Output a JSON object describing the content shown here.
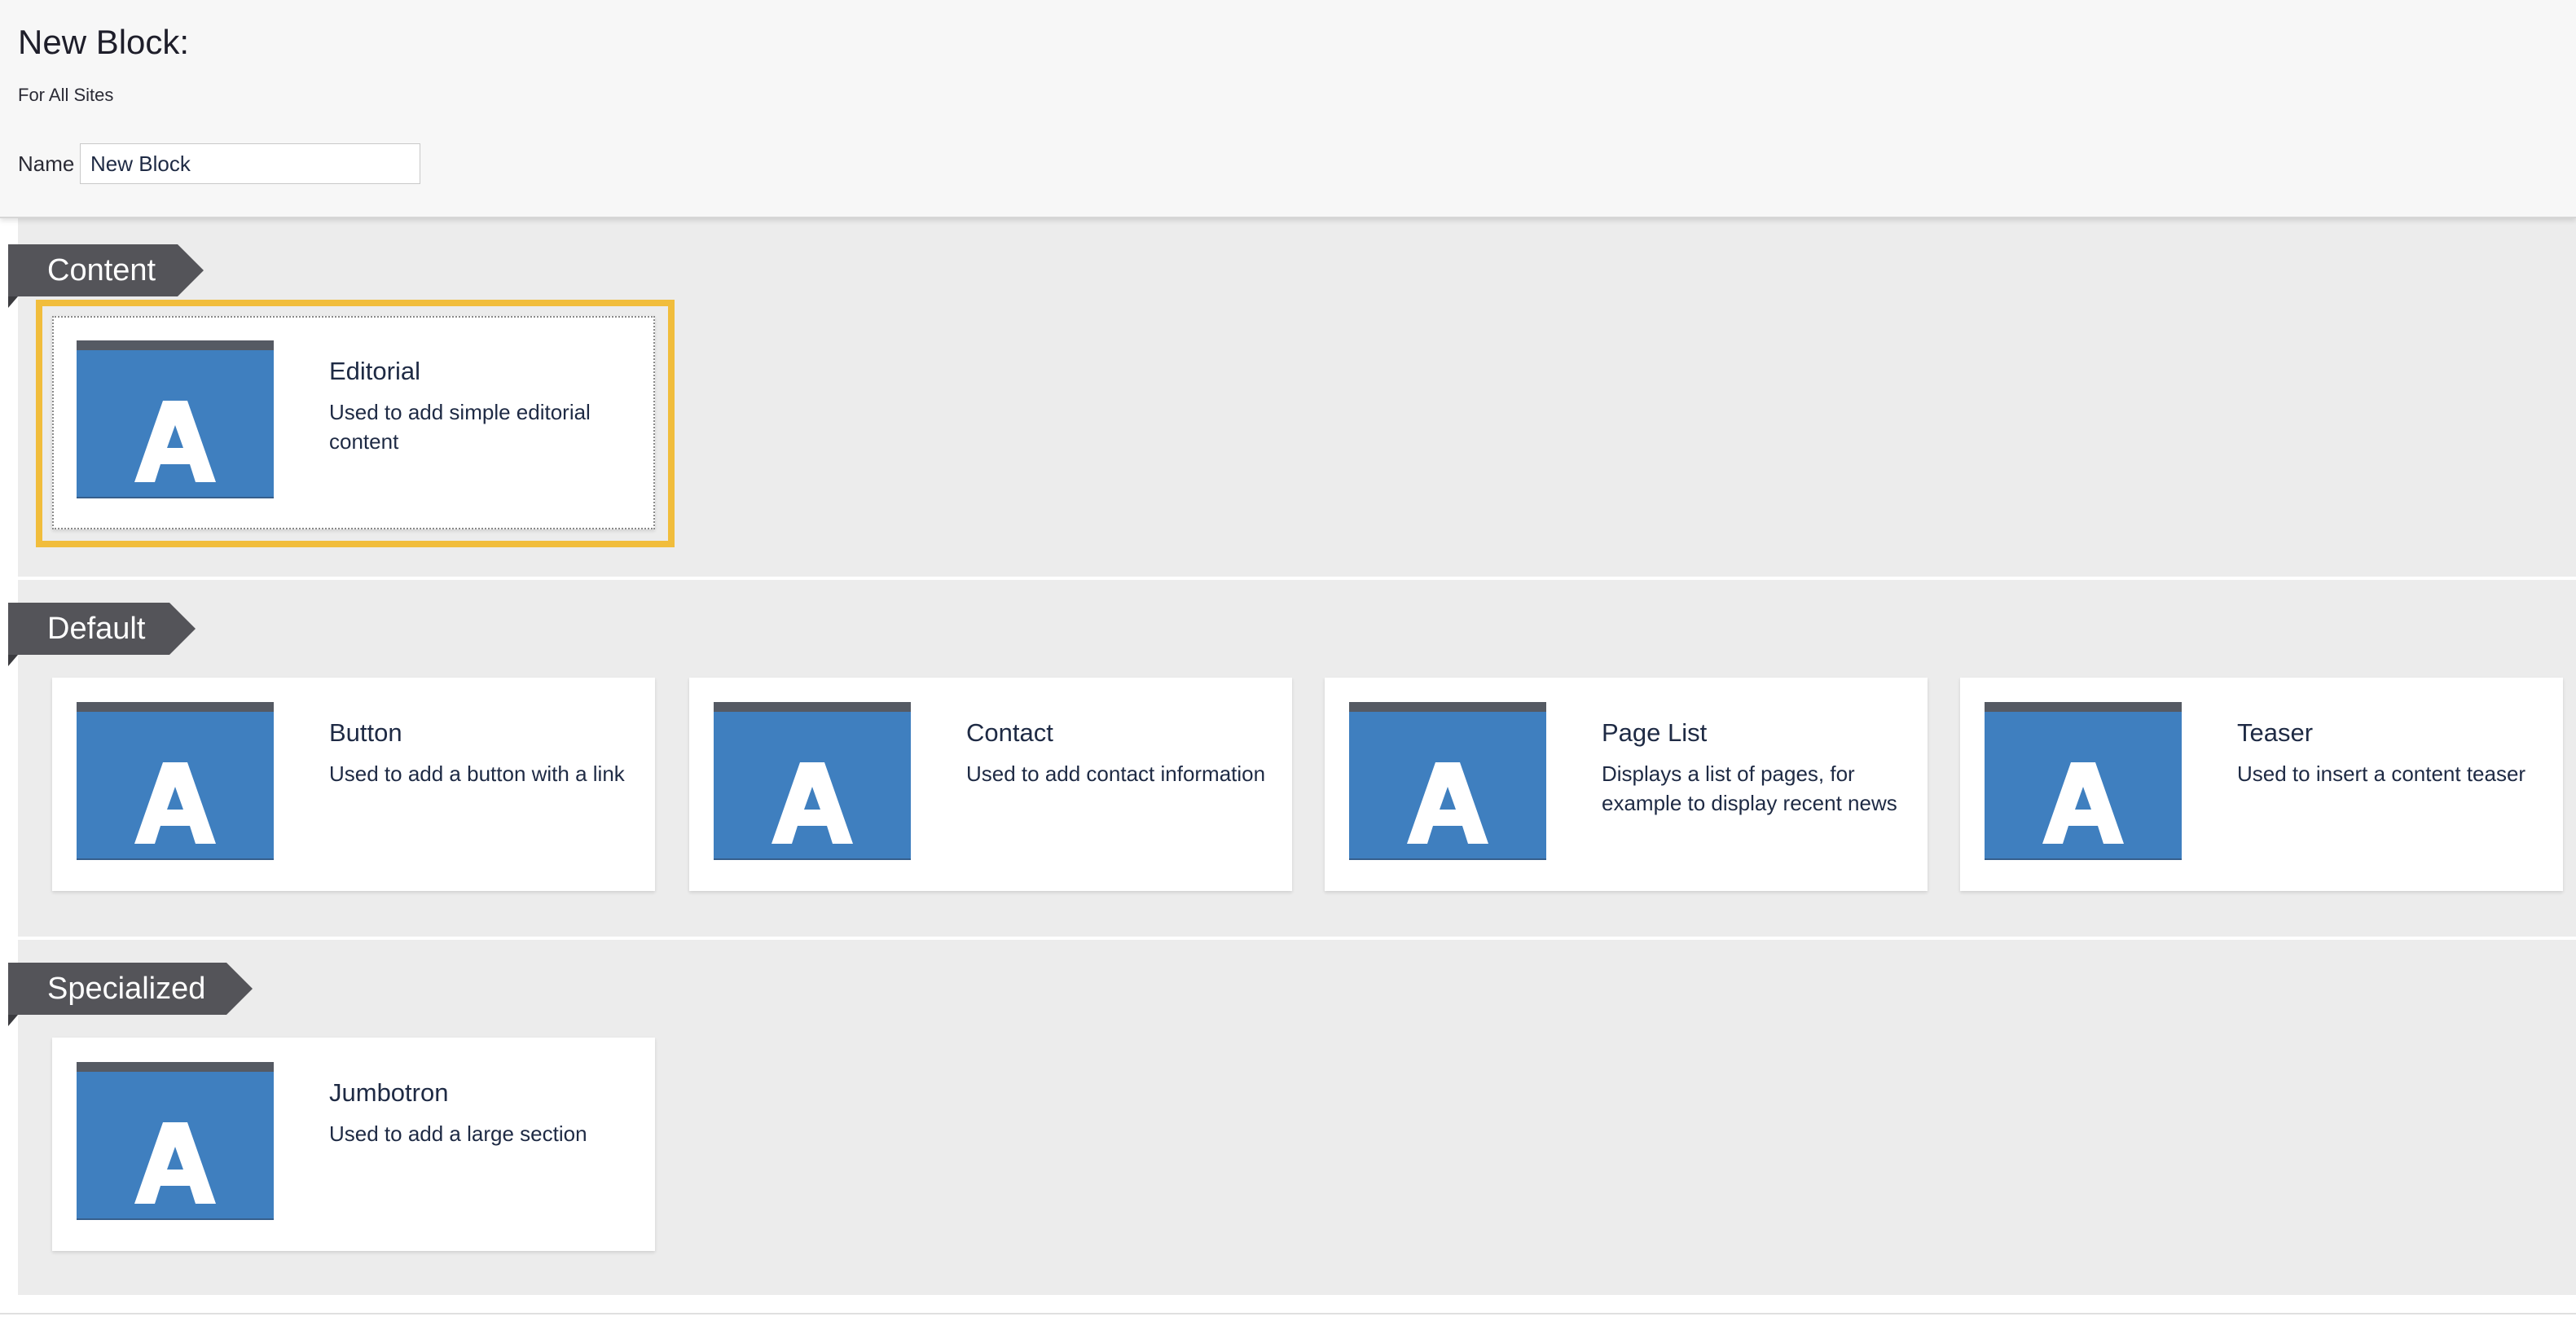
{
  "header": {
    "title": "New Block:",
    "subtitle": "For All Sites",
    "name_label": "Name",
    "name_value": "New Block"
  },
  "sections": [
    {
      "label": "Content",
      "cards": [
        {
          "title": "Editorial",
          "description": "Used to add simple editorial content",
          "icon": "letter-a-icon",
          "selected": true
        }
      ]
    },
    {
      "label": "Default",
      "cards": [
        {
          "title": "Button",
          "description": "Used to add a button with a link",
          "icon": "letter-a-icon"
        },
        {
          "title": "Contact",
          "description": "Used to add contact information",
          "icon": "letter-a-icon"
        },
        {
          "title": "Page List",
          "description": "Displays a list of pages, for example to display recent news",
          "icon": "letter-a-icon"
        },
        {
          "title": "Teaser",
          "description": "Used to insert a content teaser",
          "icon": "letter-a-icon"
        }
      ]
    },
    {
      "label": "Specialized",
      "cards": [
        {
          "title": "Jumbotron",
          "description": "Used to add a large section",
          "icon": "letter-a-icon"
        }
      ]
    }
  ],
  "colors": {
    "header_bg": "#f7f7f7",
    "section_bg": "#ececec",
    "section_tag": "#545459",
    "thumb_blue": "#3f7fbf",
    "thumb_bar": "#555a63",
    "selection_frame": "#f1bd3c",
    "text": "#1e2a44"
  }
}
